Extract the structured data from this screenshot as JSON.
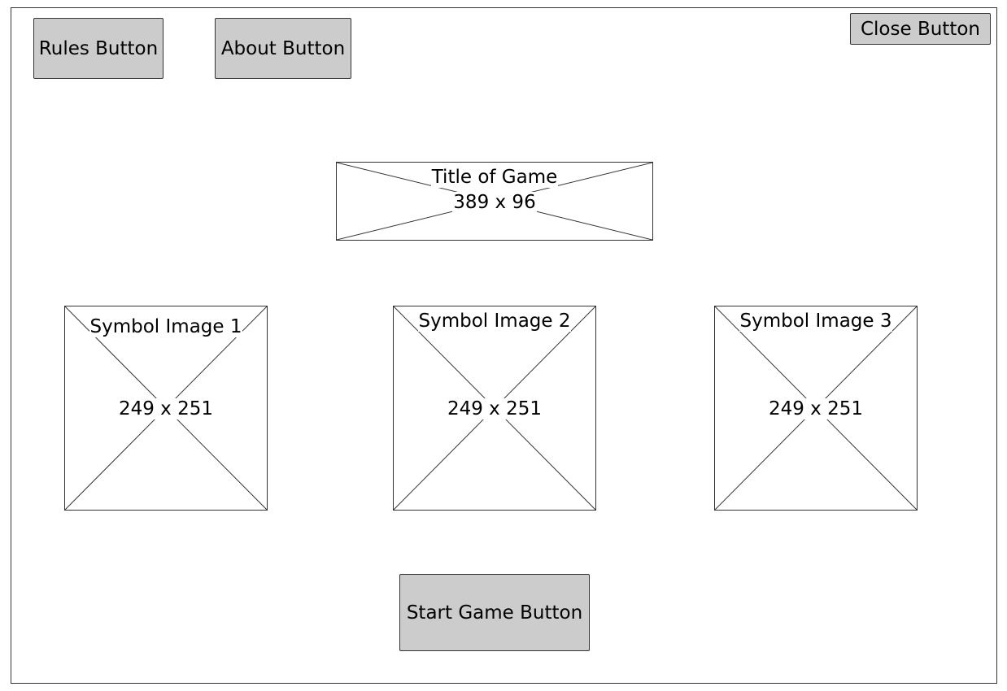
{
  "buttons": {
    "rules": "Rules Button",
    "about": "About Button",
    "close": "Close Button",
    "start": "Start Game Button"
  },
  "title_placeholder": {
    "label": "Title of Game",
    "size": "389 x 96"
  },
  "symbols": [
    {
      "label": "Symbol Image 1",
      "size": "249 x 251"
    },
    {
      "label": "Symbol Image 2",
      "size": "249 x 251"
    },
    {
      "label": "Symbol Image 3",
      "size": "249 x 251"
    }
  ]
}
